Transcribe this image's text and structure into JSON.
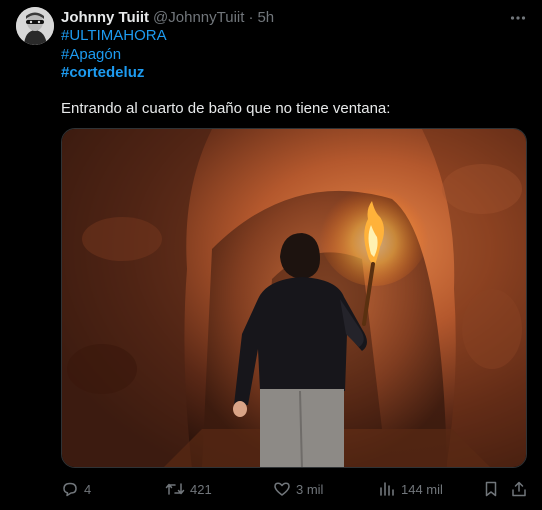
{
  "tweet": {
    "display_name": "Johnny Tuiit",
    "handle": "@JohnnyTuiit",
    "separator": "·",
    "time": "5h",
    "hashtags": [
      "#ULTIMAHORA",
      "#Apagón",
      "#cortedeluz"
    ],
    "text": "Entrando al cuarto de baño que no tiene ventana:",
    "image_icon": "photo-man-with-torch-in-cave"
  },
  "actions": {
    "replies": "4",
    "reposts": "421",
    "likes": "3 mil",
    "views": "144 mil"
  },
  "icons": [
    "more-icon",
    "reply-icon",
    "repost-icon",
    "like-icon",
    "views-icon",
    "bookmark-icon",
    "share-icon"
  ],
  "colors": {
    "background": "#000000",
    "text": "#e7e9ea",
    "muted": "#71767b",
    "link": "#1d9bf0"
  }
}
